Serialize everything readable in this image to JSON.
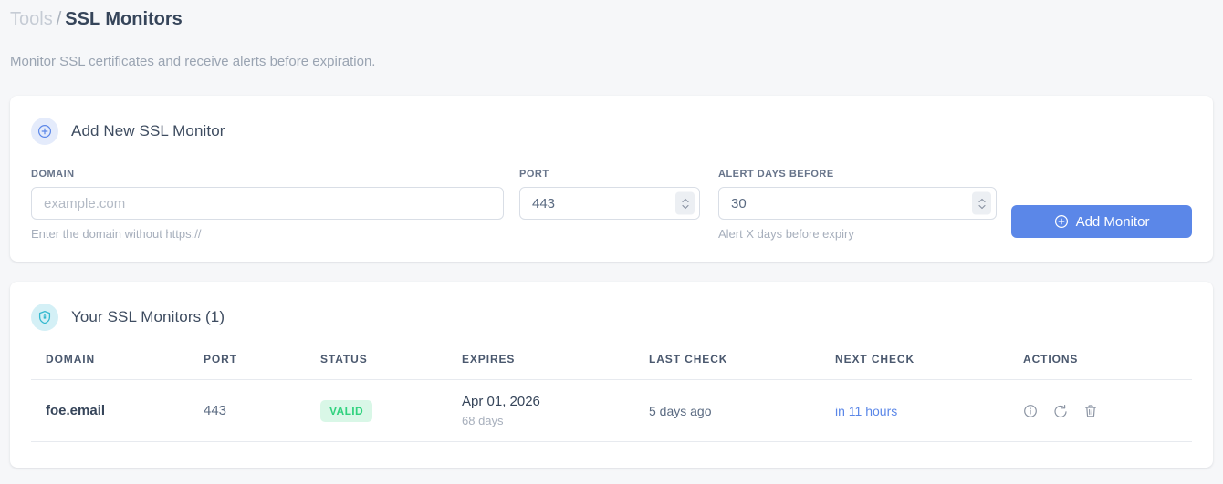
{
  "breadcrumb": {
    "section": "Tools",
    "separator": "/",
    "page": "SSL Monitors"
  },
  "subtitle": "Monitor SSL certificates and receive alerts before expiration.",
  "add_card": {
    "title": "Add New SSL Monitor",
    "fields": {
      "domain": {
        "label": "DOMAIN",
        "placeholder": "example.com",
        "helper": "Enter the domain without https://"
      },
      "port": {
        "label": "PORT",
        "value": "443"
      },
      "alert_days": {
        "label": "ALERT DAYS BEFORE",
        "value": "30",
        "helper": "Alert X days before expiry"
      }
    },
    "submit_label": "Add Monitor"
  },
  "monitors_card": {
    "title": "Your SSL Monitors (1)",
    "table": {
      "headers": [
        "DOMAIN",
        "PORT",
        "STATUS",
        "EXPIRES",
        "LAST CHECK",
        "NEXT CHECK",
        "ACTIONS"
      ],
      "rows": [
        {
          "domain": "foe.email",
          "port": "443",
          "status": "VALID",
          "expires_date": "Apr 01, 2026",
          "expires_days": "68 days",
          "last_check": "5 days ago",
          "next_check": "in 11 hours"
        }
      ]
    }
  },
  "icons": {
    "plus_circle": "plus-circle-icon",
    "shield": "shield-icon",
    "info": "info-icon",
    "refresh": "refresh-icon",
    "trash": "trash-icon"
  },
  "colors": {
    "accent_blue": "#5b87e8",
    "accent_cyan": "#35b9cf",
    "valid_green": "#30d27e",
    "valid_green_bg": "#d9f7e7",
    "page_bg": "#f6f7f9"
  }
}
